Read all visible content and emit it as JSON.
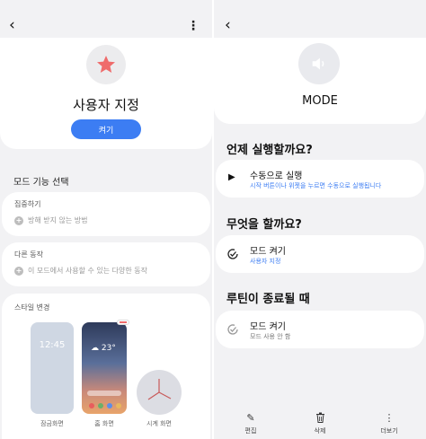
{
  "left_panel": {
    "title": "사용자 지정",
    "turn_on_label": "켜기",
    "section_title": "모드 기능 선택",
    "focus": {
      "label": "집중하기",
      "item": "방해 받지 않는 방법"
    },
    "other": {
      "label": "다른 동작",
      "item": "이 모드에서 사용할 수 있는 다양한 동작"
    },
    "style": {
      "label": "스타일 변경",
      "lock_time": "12:45",
      "weather_temp": "23°",
      "lock_label": "잠금화면",
      "home_label": "홈 화면",
      "clock_label": "시계 화면"
    },
    "accent_color": "#ef6b6b"
  },
  "right_panel": {
    "title": "MODE",
    "when_heading": "언제 실행할까요?",
    "when_item": {
      "title": "수동으로 실행",
      "subtitle": "시작 버튼이나 위젯을 누르면 수동으로 실행됩니다"
    },
    "what_heading": "무엇을 할까요?",
    "what_item": {
      "title": "모드 켜기",
      "subtitle": "사용자 지정"
    },
    "end_heading": "루틴이 종료될 때",
    "end_item": {
      "title": "모드 켜기",
      "subtitle": "모드 사용 안 함"
    },
    "bottom_bar": {
      "edit": "편집",
      "delete": "삭제",
      "more": "더보기"
    },
    "accent_color": "#3c7df3"
  }
}
